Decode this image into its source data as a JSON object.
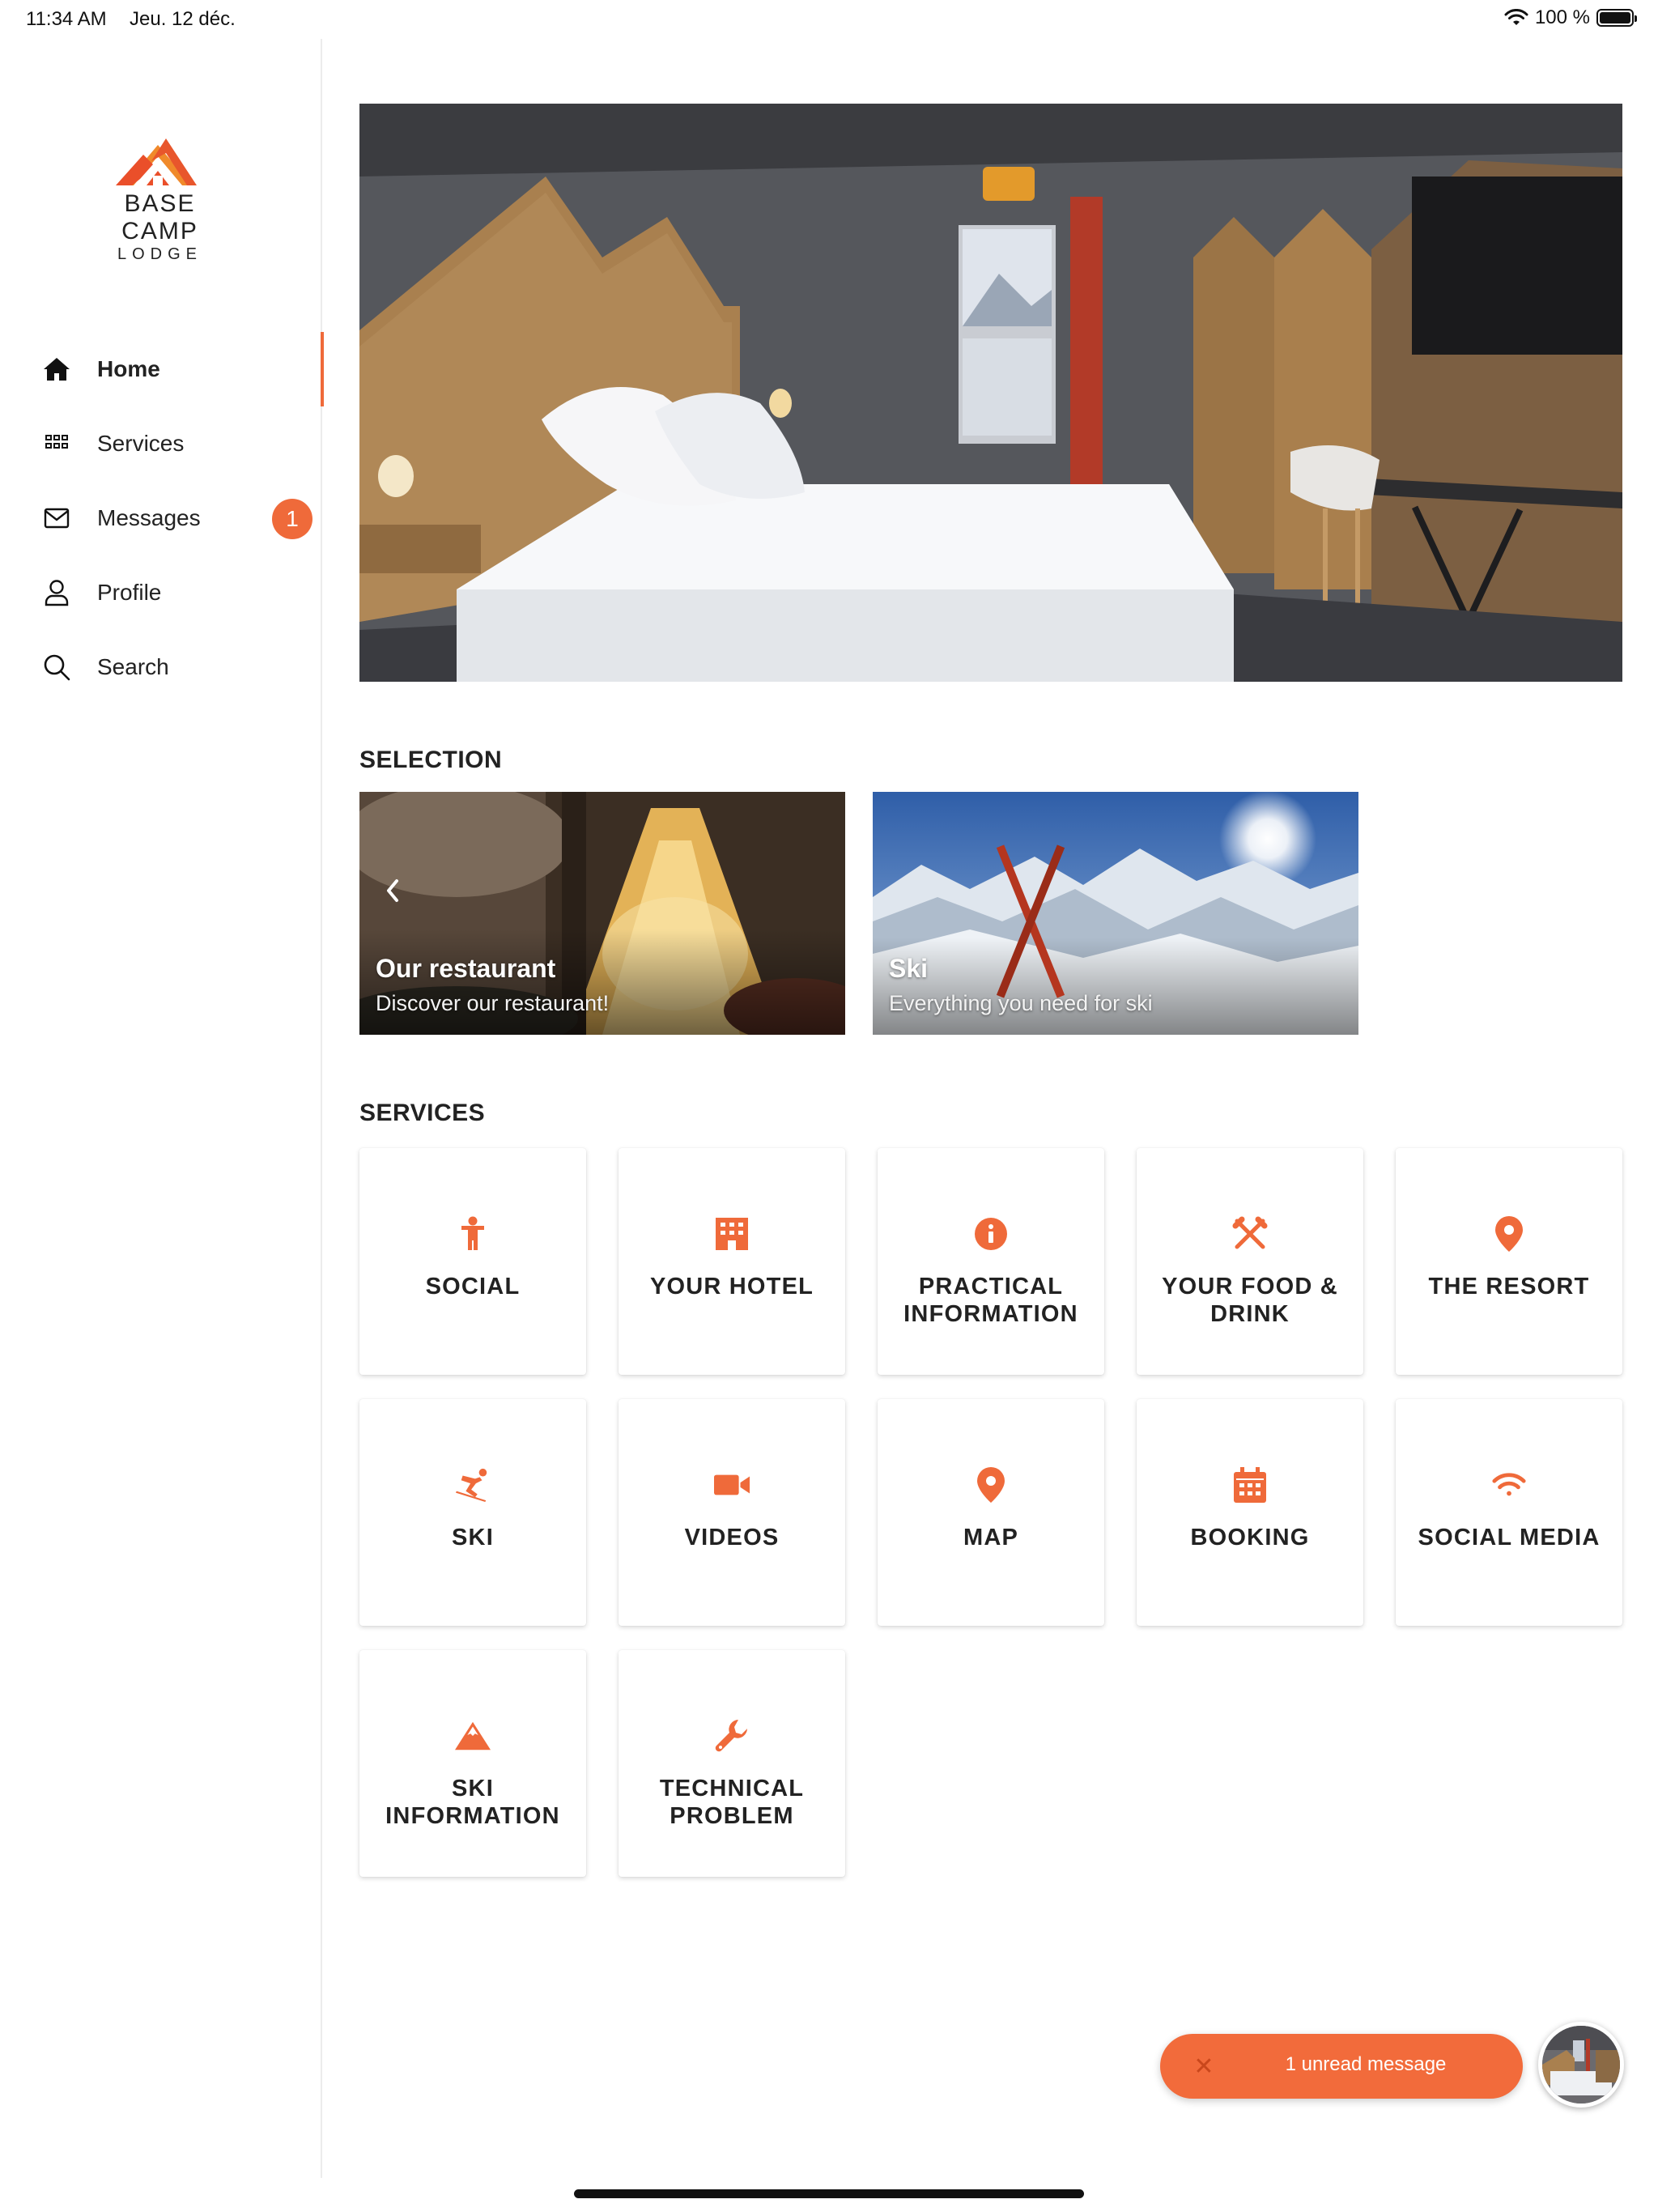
{
  "status_bar": {
    "time": "11:34 AM",
    "date": "Jeu. 12 déc.",
    "battery": "100 %"
  },
  "brand": {
    "name": "BASE CAMP",
    "sub": "LODGE",
    "accent": "#ef6a3a"
  },
  "nav": [
    {
      "label": "Home",
      "icon": "home-icon"
    },
    {
      "label": "Services",
      "icon": "grid-icon"
    },
    {
      "label": "Messages",
      "icon": "envelope-icon",
      "badge": "1"
    },
    {
      "label": "Profile",
      "icon": "user-icon"
    },
    {
      "label": "Search",
      "icon": "search-icon"
    }
  ],
  "selection": {
    "title": "SELECTION",
    "cards": [
      {
        "title": "Our restaurant",
        "subtitle": "Discover our restaurant!"
      },
      {
        "title": "Ski",
        "subtitle": "Everything you need for ski"
      }
    ]
  },
  "services": {
    "title": "SERVICES",
    "items": [
      {
        "label": "SOCIAL",
        "icon": "person-icon"
      },
      {
        "label": "YOUR HOTEL",
        "icon": "building-icon"
      },
      {
        "label": "PRACTICAL INFORMATION",
        "icon": "info-icon"
      },
      {
        "label": "YOUR FOOD & DRINK",
        "icon": "utensils-icon"
      },
      {
        "label": "THE RESORT",
        "icon": "map-pin-icon"
      },
      {
        "label": "SKI",
        "icon": "skier-icon"
      },
      {
        "label": "VIDEOS",
        "icon": "video-camera-icon"
      },
      {
        "label": "MAP",
        "icon": "map-pin-icon"
      },
      {
        "label": "BOOKING",
        "icon": "calendar-icon"
      },
      {
        "label": "SOCIAL MEDIA",
        "icon": "wifi-icon"
      },
      {
        "label": "SKI INFORMATION",
        "icon": "mountain-icon"
      },
      {
        "label": "TECHNICAL PROBLEM",
        "icon": "wrench-icon"
      }
    ]
  },
  "toast": {
    "text": "1 unread message"
  }
}
